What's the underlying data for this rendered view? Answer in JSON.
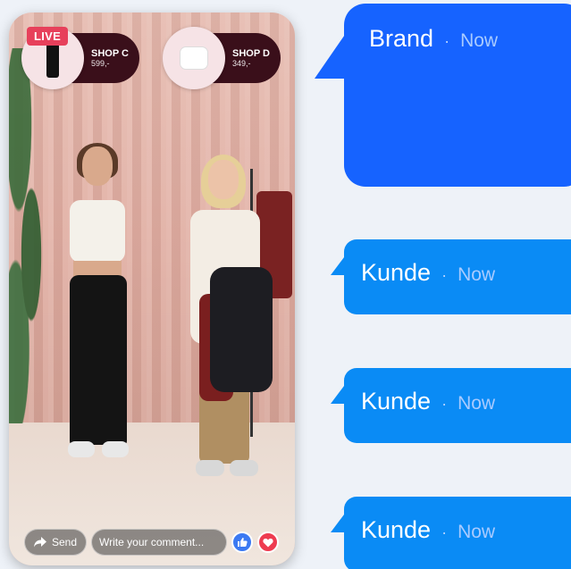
{
  "stream": {
    "live_label": "LIVE",
    "products": [
      {
        "name": "SHOP C",
        "price": "599,-",
        "thumb": "leggings"
      },
      {
        "name": "SHOP D",
        "price": "349,-",
        "thumb": "sports-bra"
      }
    ],
    "send_label": "Send",
    "comment_placeholder": "Write your comment...",
    "reactions": [
      "like-icon",
      "heart-icon"
    ]
  },
  "chat": {
    "brand": {
      "sender": "Brand",
      "separator": "·",
      "time": "Now"
    },
    "customers": [
      {
        "sender": "Kunde",
        "separator": "·",
        "time": "Now"
      },
      {
        "sender": "Kunde",
        "separator": "·",
        "time": "Now"
      },
      {
        "sender": "Kunde",
        "separator": "·",
        "time": "Now"
      }
    ]
  },
  "colors": {
    "brand_bubble": "#1663ff",
    "customer_bubble": "#0a8bf5",
    "live_badge": "#e7405b",
    "product_pill": "#3a0f1a",
    "like": "#3b79f2",
    "love": "#ee3b50"
  }
}
